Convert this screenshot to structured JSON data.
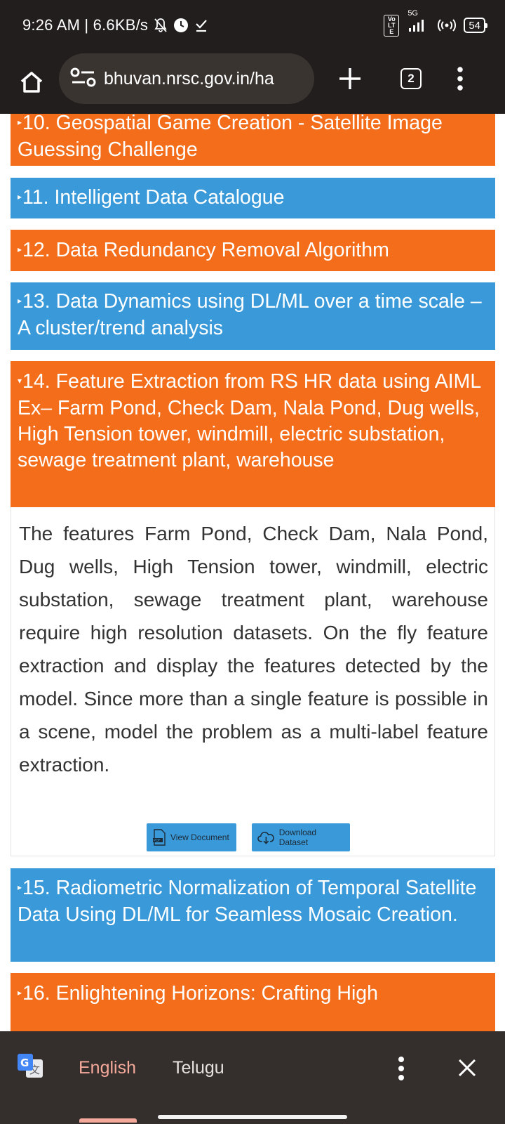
{
  "status_bar": {
    "time_speed": "9:26 AM | 6.6KB/s",
    "network": "5G",
    "volte": "Vo LTE",
    "battery": "54"
  },
  "browser": {
    "url": "bhuvan.nrsc.gov.in/ha",
    "tab_count": "2"
  },
  "sections": [
    {
      "title": "10. Geospatial Game Creation - Satellite Image Guessing Challenge",
      "color": "#f36d1b"
    },
    {
      "title": "11. Intelligent Data Catalogue",
      "color": "#3a9ad9"
    },
    {
      "title": "12. Data Redundancy Removal Algorithm",
      "color": "#f36d1b"
    },
    {
      "title": "13. Data Dynamics using DL/ML over a time scale – A cluster/trend analysis",
      "color": "#3a9ad9"
    },
    {
      "title": "14. Feature Extraction from RS HR data using AIML Ex– Farm Pond, Check Dam, Nala Pond, Dug wells, High Tension tower, windmill, electric substation, sewage treatment plant, warehouse",
      "color": "#f36d1b",
      "expanded": true
    },
    {
      "title": "15. Radiometric Normalization of Temporal Satellite Data Using DL/ML for Seamless Mosaic Creation.",
      "color": "#3a9ad9"
    },
    {
      "title": "16. Enlightening Horizons: Crafting High",
      "color": "#f36d1b"
    }
  ],
  "expanded_panel": {
    "description": "The features Farm Pond, Check Dam, Nala Pond, Dug wells, High Tension tower, windmill, electric substation, sewage treatment plant, warehouse require high resolution datasets. On the fly feature extraction and display the features detected by the model. Since more than a single feature is possible in a scene, model the problem as a multi-label feature extraction.",
    "view_document_label": "View Document",
    "download_dataset_label": "Download Dataset"
  },
  "translate_bar": {
    "language_active": "English",
    "language_other": "Telugu"
  }
}
